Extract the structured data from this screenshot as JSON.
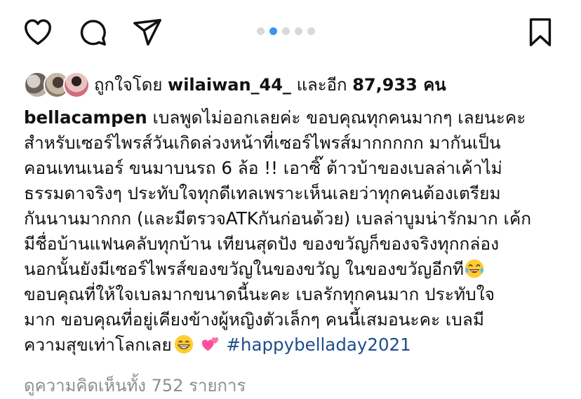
{
  "carousel": {
    "count": 5,
    "active_index": 1
  },
  "likes": {
    "prefix": "ถูกใจโดย",
    "username": "wilaiwan_44_",
    "connector": "และอีก",
    "count": "87,933",
    "suffix": "คน"
  },
  "caption": {
    "username": "bellacampen",
    "line1": " เบลพูดไม่ออกเลยค่ะ ขอบคุณทุกคนมากๆ เลยนะคะ",
    "line2": "สำหรับเซอร์ไพรส์วันเกิดล่วงหน้าที่เซอร์ไพรส์มากกกกก มากันเป็น",
    "line3": "คอนเทนเนอร์ ขนมาบนรถ 6 ล้อ !! เอาซิ๊ ต้าวบ้าของเบลล่าเค้าไม่",
    "line4": "ธรรมดาจริงๆ ประทับใจทุกดีเทลเพราะเห็นเลยว่าทุกคนต้องเตรียม",
    "line5": "กันนานมากกก (และมีตรวจATKกันก่อนด้วย) เบลล่าบูมน่ารักมาก เค้ก",
    "line6": "มีชื่อบ้านแฟนคลับทุกบ้าน เทียนสุดปัง ของขวัญก็ของจริงทุกกล่อง",
    "line7": "นอกนั้นยังมีเซอร์ไพรส์ของขวัญในของขวัญ ในของขวัญอีกที",
    "line8": "ขอบคุณที่ให้ใจเบลมากขนาดนี้นะคะ เบลรักทุกคนมาก ประทับใจ",
    "line9": "มาก ขอบคุณที่อยู่เคียงข้างผู้หญิงตัวเล็กๆ คนนี้เสมอนะคะ เบลมี",
    "line10": "ความสุขเท่าโลกเลย",
    "hashtag": "#happybelladay2021",
    "emojis": [
      "laughing-tears-emoji",
      "grinning-emoji",
      "two-hearts-emoji"
    ]
  },
  "comments": {
    "label": "ดูความคิดเห็นทั้ง 752 รายการ"
  },
  "colors": {
    "accent": "#3797f0",
    "hashtag": "#1f4d8c",
    "muted": "#8e8e8e",
    "dot_inactive": "#d9d9d9"
  },
  "icons": [
    "heart-icon",
    "comment-icon",
    "share-icon",
    "bookmark-icon"
  ]
}
